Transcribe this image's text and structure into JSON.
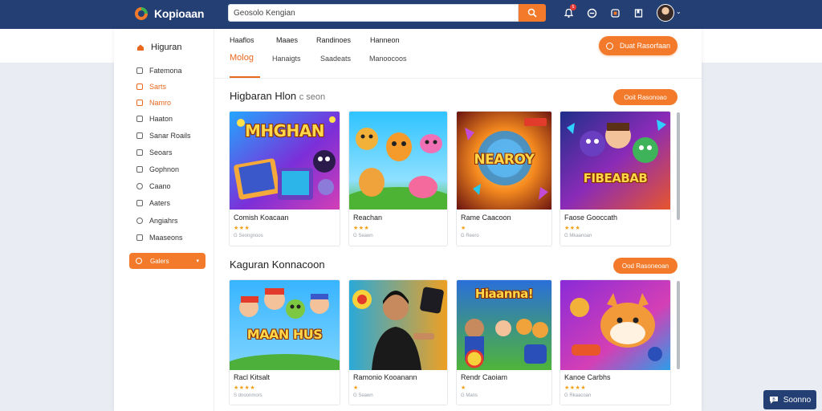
{
  "header": {
    "brand": "Kopioaan",
    "search": {
      "value": "Geosolo Kengian",
      "placeholder": ""
    },
    "notifications_count": "5",
    "icons": [
      "bell-icon",
      "chat-icon",
      "gift-icon",
      "bookmark-icon"
    ]
  },
  "sidebar": {
    "title": "Higuran",
    "items": [
      {
        "label": "Fatemona",
        "icon": "list-icon"
      },
      {
        "label": "Sarts",
        "icon": "star-icon",
        "active": true
      },
      {
        "label": "Namro",
        "icon": "flame-icon",
        "active": true
      },
      {
        "label": "Haaton",
        "icon": "grid-icon"
      },
      {
        "label": "Sanar Roails",
        "icon": "tag-icon"
      },
      {
        "label": "Seoars",
        "icon": "sliders-icon"
      },
      {
        "label": "Gophnon",
        "icon": "folder-icon"
      },
      {
        "label": "Caano",
        "icon": "circle-icon"
      },
      {
        "label": "Aaters",
        "icon": "triangle-icon"
      },
      {
        "label": "Angiahrs",
        "icon": "user-icon"
      },
      {
        "label": "Maaseons",
        "icon": "box-icon"
      }
    ],
    "cta_label": "Galers"
  },
  "nav": {
    "top_links": [
      "Haaflos",
      "Maaes",
      "Randinoes",
      "Hanneon"
    ],
    "tabs": [
      {
        "label": "Molog",
        "active": true
      },
      {
        "label": "Hanaigts"
      },
      {
        "label": "Saadeats"
      },
      {
        "label": "Manoocoos"
      }
    ],
    "header_button": "Duat Rasorfaan"
  },
  "sections": [
    {
      "title": "Higbaran Hlon",
      "title_suffix": "c seon",
      "button": "Ooit Rasonoao",
      "games": [
        {
          "name": "Comish Koacaan",
          "art": "MHGHAN",
          "stars": "★★★",
          "meta": "G Seongnoos"
        },
        {
          "name": "Reachan",
          "art": "",
          "stars": "★★★",
          "meta": "G Seawn"
        },
        {
          "name": "Rame Caacoon",
          "art": "NEAROY",
          "stars": "★",
          "meta": "G Reero"
        },
        {
          "name": "Faose Gooccath",
          "art": "FIBEABAB",
          "stars": "★★★",
          "meta": "G Mkaanoan"
        }
      ]
    },
    {
      "title": "Kaguran Konnacoon",
      "title_suffix": "",
      "button": "Ood Rasoneoan",
      "games": [
        {
          "name": "Racl Kitsalt",
          "art": "MAAN HUS",
          "stars": "★★★★",
          "meta": "S dnoonmors"
        },
        {
          "name": "Ramonio Kooanann",
          "art": "",
          "stars": "★",
          "meta": "G Seawn"
        },
        {
          "name": "Rendr Caoiam",
          "art": "Hiaanna!",
          "stars": "★",
          "meta": "G Mans"
        },
        {
          "name": "Kanoe Carbhs",
          "art": "",
          "stars": "★★★★",
          "meta": "G Rkaacoan"
        }
      ]
    }
  ],
  "chat": {
    "label": "Soonno",
    "icon": "chat-bubble-icon"
  },
  "colors": {
    "accent": "#f27a2a",
    "topbar": "#243f73",
    "active_text": "#e8681e"
  }
}
